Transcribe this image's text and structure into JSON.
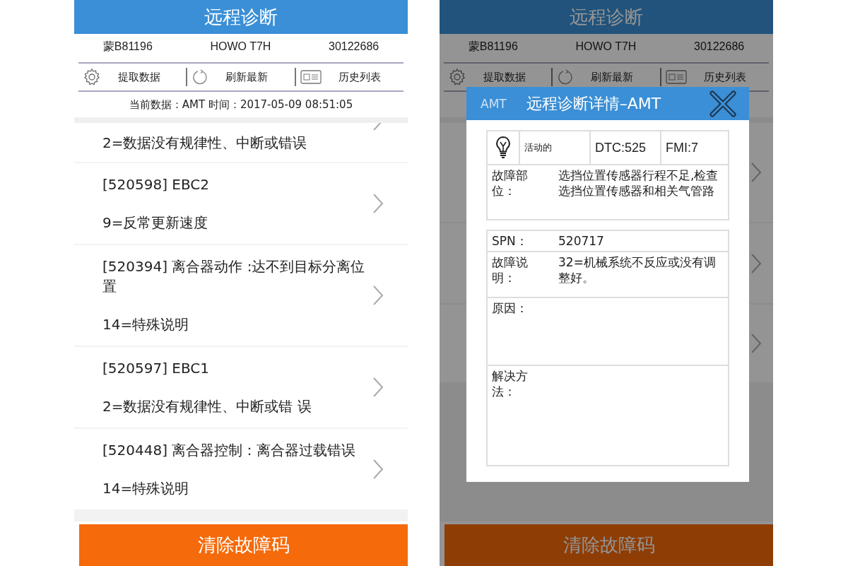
{
  "screens": [
    {
      "title": "远程诊断",
      "dimmed": false,
      "vehicle": [
        "蒙B81196",
        "HOWO T7H",
        "30122686"
      ],
      "toolbar": [
        {
          "kind": "gear",
          "label": "提取数据"
        },
        {
          "kind": "refresh",
          "label": "刷新最新"
        },
        {
          "kind": "card",
          "label": "历史列表"
        }
      ],
      "current_data": "当前数据：AMT 时间：2017-05-09 08:51:05",
      "faults": [
        {
          "description": "2=数据没有规律性、中断或错误"
        },
        {
          "code_line": "[520598] EBC2",
          "description": "9=反常更新速度"
        },
        {
          "code_line": "[520394] 离合器动作 :达不到目标分离位置",
          "description": "14=特殊说明"
        },
        {
          "code_line": "[520597] EBC1",
          "description": "2=数据没有规律性、中断或错 误"
        },
        {
          "code_line": "[520448] 离合器控制：离合器过载错误",
          "description": "14=特殊说明"
        }
      ],
      "clear_button": "清除故障码"
    },
    {
      "title": "远程诊断",
      "dimmed": true,
      "vehicle": [
        "蒙B81196",
        "HOWO T7H",
        "30122686"
      ],
      "toolbar": [
        {
          "kind": "gear",
          "label": "提取数据"
        },
        {
          "kind": "refresh",
          "label": "刷新最新"
        },
        {
          "kind": "card",
          "label": "历史列表"
        }
      ],
      "clear_button": "清除故障码",
      "dialog": {
        "tag": "AMT",
        "title": "远程诊断详情–AMT",
        "status": "活动的",
        "dtc": "DTC:525",
        "fmi": "FMI:7",
        "location": {
          "label": "故障部位：",
          "value": "选挡位置传感器行程不足,检查选挡位置传感器和相关气管路"
        },
        "details": [
          {
            "label": "SPN：",
            "value": "520717"
          },
          {
            "label": "故障说明：",
            "value": "32=机械系统不反应或没有调整好。"
          },
          {
            "label": "原因："
          },
          {
            "label": "解决方法："
          }
        ]
      }
    }
  ]
}
